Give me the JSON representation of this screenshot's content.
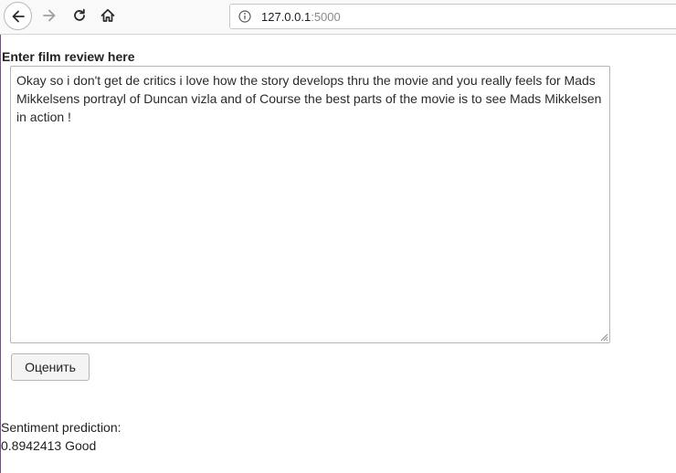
{
  "browser": {
    "url_host": "127.0.0.1",
    "url_port": ":5000",
    "icons": {
      "back": "back-arrow-icon",
      "forward": "forward-arrow-icon",
      "reload": "reload-icon",
      "home": "home-icon",
      "site_info": "info-icon"
    }
  },
  "form": {
    "label": "Enter film review here",
    "review_text": "Okay so i don't get de critics i love how the story develops thru the movie and you really feels for Mads Mikkelsens portrayl of Duncan vizla and of Course the best parts of the movie is to see Mads Mikkelsen in action !",
    "submit_label": "Оценить"
  },
  "result": {
    "label": "Sentiment prediction:",
    "value": "0.8942413 Good"
  }
}
